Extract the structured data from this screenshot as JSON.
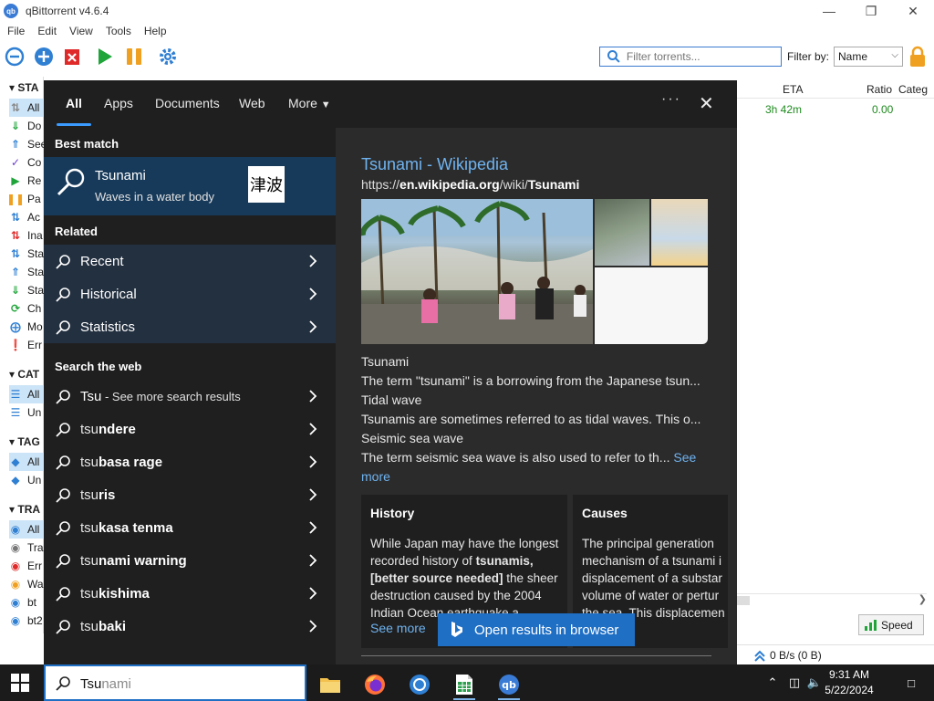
{
  "qbittorrent": {
    "title": "qBittorrent v4.6.4",
    "menu": [
      "File",
      "Edit",
      "View",
      "Tools",
      "Help"
    ],
    "filter_placeholder": "Filter torrents...",
    "filter_by_label": "Filter by:",
    "filter_by_value": "Name",
    "sidebar": {
      "status_header": "STA",
      "status_items": [
        "All",
        "Do",
        "See",
        "Co",
        "Re",
        "Pa",
        "Ac",
        "Ina",
        "Sta",
        "Sta",
        "Sta",
        "Ch",
        "Mo",
        "Err"
      ],
      "categories_header": "CAT",
      "category_items": [
        "All",
        "Un"
      ],
      "tags_header": "TAG",
      "tag_items": [
        "All",
        "Un"
      ],
      "trackers_header": "TRA",
      "tracker_items": [
        "All",
        "Tra",
        "Err",
        "Wa",
        "bt",
        "bt2"
      ]
    },
    "columns": {
      "eta": "ETA",
      "ratio": "Ratio",
      "category": "Categ"
    },
    "row": {
      "eta": "3h 42m",
      "ratio": "0.00"
    },
    "speed_button": "Speed",
    "status_bar": "0 B/s (0 B)"
  },
  "search": {
    "tabs": [
      "All",
      "Apps",
      "Documents",
      "Web",
      "More"
    ],
    "best_match_header": "Best match",
    "best_match": {
      "title": "Tsunami",
      "subtitle": "Waves in a water body",
      "thumb": "津波"
    },
    "related_header": "Related",
    "related": [
      "Recent",
      "Historical",
      "Statistics"
    ],
    "web_header": "Search the web",
    "web_results": [
      {
        "typed": "Tsu",
        "rest": "",
        "suffix": " - See more search results"
      },
      {
        "typed": "tsu",
        "rest": "ndere",
        "suffix": ""
      },
      {
        "typed": "tsu",
        "rest": "basa rage",
        "suffix": ""
      },
      {
        "typed": "tsu",
        "rest": "ris",
        "suffix": ""
      },
      {
        "typed": "tsu",
        "rest": "kasa tenma",
        "suffix": ""
      },
      {
        "typed": "tsu",
        "rest": "nami warning",
        "suffix": ""
      },
      {
        "typed": "tsu",
        "rest": "kishima",
        "suffix": ""
      },
      {
        "typed": "tsu",
        "rest": "baki",
        "suffix": ""
      }
    ],
    "preview": {
      "title": "Tsunami - Wikipedia",
      "url_prefix": "https://",
      "url_domain": "en.wikipedia.org",
      "url_path": "/wiki/",
      "url_page": "Tsunami",
      "heading1": "Tsunami",
      "text1": "The term \"tsunami\" is a borrowing from the Japanese tsun...",
      "heading2": "Tidal wave",
      "text2": "Tsunamis are sometimes referred to as tidal waves. This o...",
      "heading3": "Seismic sea wave",
      "text3": "The term seismic sea wave is also used to refer to th...",
      "see_more": "See",
      "see_more2": "more",
      "cards": [
        {
          "title": "History",
          "body_html_parts": [
            "While Japan may have the longest recorded history of ",
            "tsunamis",
            ", ",
            "[better source needed]",
            " the sheer destruction caused by the 2004 Indian Ocean earthquake a..."
          ],
          "more": "See more"
        },
        {
          "title": "Causes",
          "body": "The principal generation mechanism of a tsunami i displacement of a substar volume of water or pertur the sea. This displacemen",
          "more": "re"
        }
      ],
      "open_browser": "Open results in browser"
    }
  },
  "taskbar": {
    "search_typed": "Tsu",
    "search_rest": "nami",
    "time": "9:31 AM",
    "date": "5/22/2024"
  }
}
